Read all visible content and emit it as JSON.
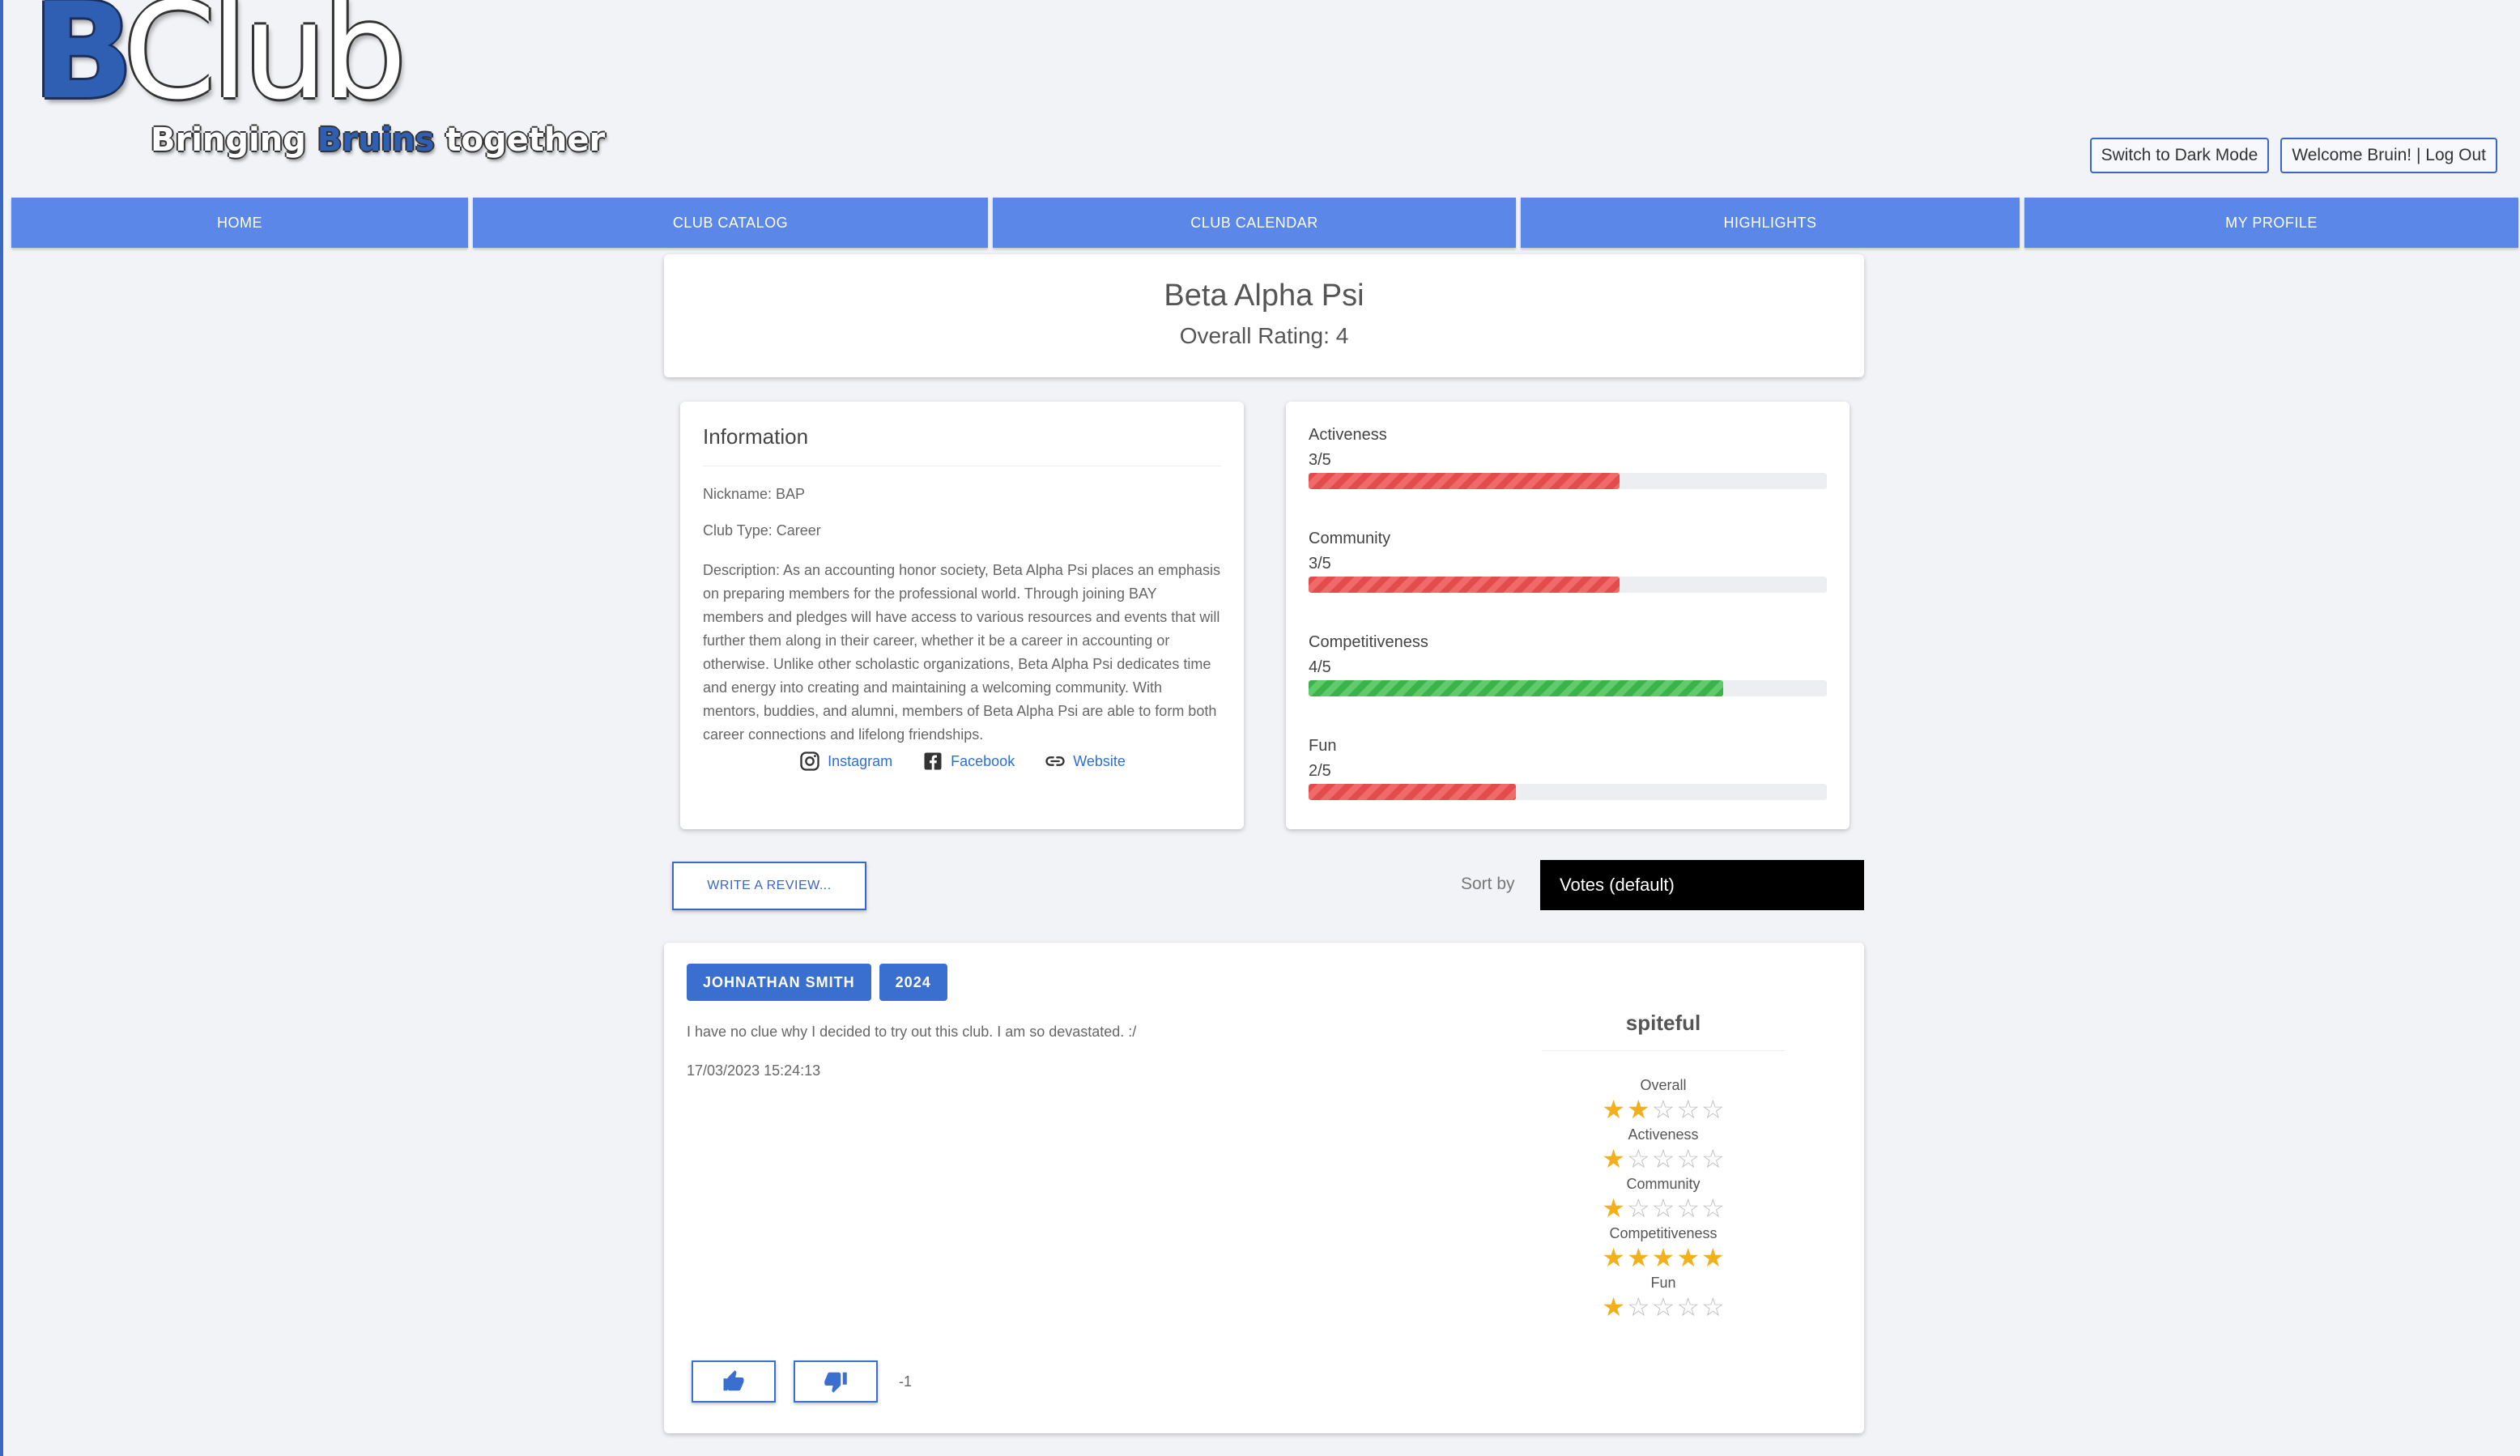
{
  "logo": {
    "b": "B",
    "club": "Club",
    "tagline_pre": "Bringing ",
    "tagline_bold": "Bruins",
    "tagline_post": " together"
  },
  "header": {
    "dark_mode_label": "Switch to Dark Mode",
    "welcome_label": "Welcome Bruin! | Log Out"
  },
  "nav": [
    "HOME",
    "CLUB CATALOG",
    "CLUB CALENDAR",
    "HIGHLIGHTS",
    "MY PROFILE"
  ],
  "club": {
    "name": "Beta Alpha Psi",
    "overall_label": "Overall Rating:",
    "overall_value": "4"
  },
  "info": {
    "title": "Information",
    "nickname": "Nickname: BAP",
    "club_type": "Club Type: Career",
    "description": "Description: As an accounting honor society, Beta Alpha Psi places an emphasis on preparing members for the professional world. Through joining BAY members and pledges will have access to various resources and events that will further them along in their career, whether it be a career in accounting or otherwise. Unlike other scholastic organizations, Beta Alpha Psi dedicates time and energy into creating and maintaining a welcoming community. With mentors, buddies, and alumni, members of Beta Alpha Psi are able to form both career connections and lifelong friendships.",
    "links": {
      "instagram": "Instagram",
      "facebook": "Facebook",
      "website": "Website"
    }
  },
  "ratings": [
    {
      "name": "Activeness",
      "value": "3/5",
      "fraction": 0.6,
      "color": "#e24c4c"
    },
    {
      "name": "Community",
      "value": "3/5",
      "fraction": 0.6,
      "color": "#e24c4c"
    },
    {
      "name": "Competitiveness",
      "value": "4/5",
      "fraction": 0.8,
      "color": "#3cb34a"
    },
    {
      "name": "Fun",
      "value": "2/5",
      "fraction": 0.4,
      "color": "#e24c4c"
    }
  ],
  "actions": {
    "write_review": "WRITE A REVIEW...",
    "sort_label": "Sort by",
    "sort_value": "Votes (default)"
  },
  "review": {
    "author": "JOHNATHAN SMITH",
    "year": "2024",
    "text": "I have no clue why I decided to try out this club. I am so devastated. :/",
    "date": "17/03/2023 15:24:13",
    "title": "spiteful",
    "ratings": [
      {
        "label": "Overall",
        "stars": 2
      },
      {
        "label": "Activeness",
        "stars": 1
      },
      {
        "label": "Community",
        "stars": 1
      },
      {
        "label": "Competitiveness",
        "stars": 5
      },
      {
        "label": "Fun",
        "stars": 1
      }
    ],
    "vote_count": "-1"
  }
}
